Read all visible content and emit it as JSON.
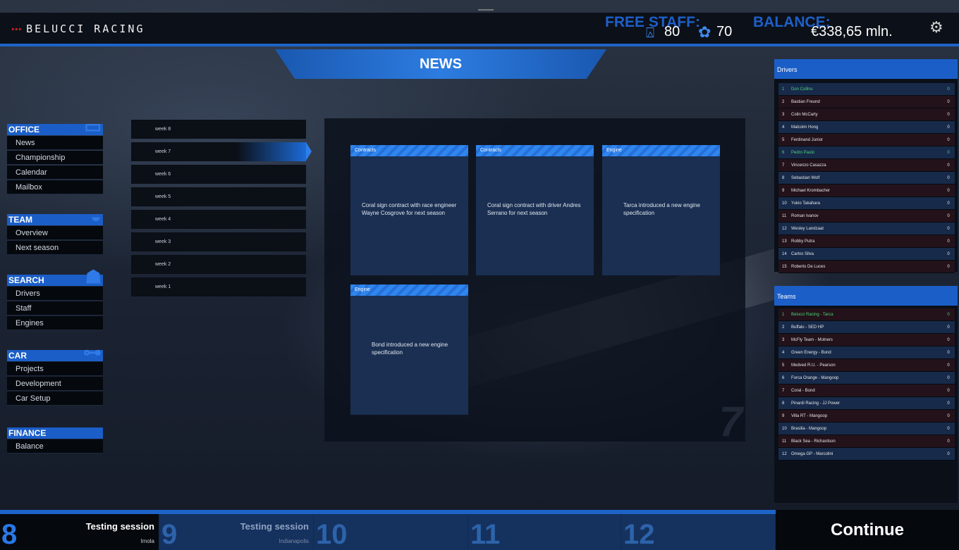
{
  "header": {
    "logo_arrows": "▸▸▸",
    "logo_text": "BELUCCI RACING",
    "free_staff_label": "FREE STAFF:",
    "engineers": "80",
    "mechanics": "70",
    "balance_label": "BALANCE:",
    "balance_value": "€338,65 mln."
  },
  "page_title": "NEWS",
  "menu": {
    "office": {
      "title": "OFFICE",
      "items": [
        "News",
        "Championship",
        "Calendar",
        "Mailbox"
      ]
    },
    "team": {
      "title": "TEAM",
      "items": [
        "Overview",
        "Next season"
      ]
    },
    "search": {
      "title": "SEARCH",
      "items": [
        "Drivers",
        "Staff",
        "Engines"
      ]
    },
    "car": {
      "title": "CAR",
      "items": [
        "Projects",
        "Development",
        "Car Setup"
      ]
    },
    "finance": {
      "title": "FINANCE",
      "items": [
        "Balance"
      ]
    }
  },
  "weeks": [
    "week 8",
    "week 7",
    "week 6",
    "week 5",
    "week 4",
    "week 3",
    "week 2",
    "week 1"
  ],
  "news_week_number": "7",
  "news": [
    {
      "category": "Contracts",
      "text": "Coral sign contract with race engineer Wayne Cosgrove for next season"
    },
    {
      "category": "Contracts",
      "text": "Coral sign contract with driver Andres Serrano for next season"
    },
    {
      "category": "Engine",
      "text": "Tarca introduced a new engine specification"
    },
    {
      "category": "Engine",
      "text": "Bond introduced a new engine specification"
    }
  ],
  "drivers": {
    "title": "Drivers",
    "rows": [
      {
        "pos": "1",
        "name": "Don Collins",
        "pts": "0"
      },
      {
        "pos": "2",
        "name": "Bastian Freund",
        "pts": "0"
      },
      {
        "pos": "3",
        "name": "Colin McCarty",
        "pts": "0"
      },
      {
        "pos": "4",
        "name": "Malcolm Hong",
        "pts": "0"
      },
      {
        "pos": "5",
        "name": "Ferdinand Junior",
        "pts": "0"
      },
      {
        "pos": "6",
        "name": "Pedro Paulo",
        "pts": "0"
      },
      {
        "pos": "7",
        "name": "Vincenzo Casazza",
        "pts": "0"
      },
      {
        "pos": "8",
        "name": "Sebastian Wolf",
        "pts": "0"
      },
      {
        "pos": "9",
        "name": "Michael Krombacher",
        "pts": "0"
      },
      {
        "pos": "10",
        "name": "Yukio Takahara",
        "pts": "0"
      },
      {
        "pos": "11",
        "name": "Roman Ivanov",
        "pts": "0"
      },
      {
        "pos": "12",
        "name": "Wesley Landzaat",
        "pts": "0"
      },
      {
        "pos": "13",
        "name": "Robby Putra",
        "pts": "0"
      },
      {
        "pos": "14",
        "name": "Carlos Silva",
        "pts": "0"
      },
      {
        "pos": "15",
        "name": "Roberto De Luces",
        "pts": "0"
      }
    ]
  },
  "teams": {
    "title": "Teams",
    "rows": [
      {
        "pos": "1",
        "name": "Belucci Racing - Tarca",
        "pts": "0"
      },
      {
        "pos": "2",
        "name": "Buffalo - SED HP",
        "pts": "0"
      },
      {
        "pos": "3",
        "name": "McFly Team - Molners",
        "pts": "0"
      },
      {
        "pos": "4",
        "name": "Green Energy - Bond",
        "pts": "0"
      },
      {
        "pos": "5",
        "name": "Medved R.U. - Pearson",
        "pts": "0"
      },
      {
        "pos": "6",
        "name": "Forca Orange - Mangoop",
        "pts": "0"
      },
      {
        "pos": "7",
        "name": "Coral - Bond",
        "pts": "0"
      },
      {
        "pos": "8",
        "name": "Pinardi Racing - JJ Power",
        "pts": "0"
      },
      {
        "pos": "9",
        "name": "Villa RT - Mangoop",
        "pts": "0"
      },
      {
        "pos": "10",
        "name": "Brasilia - Mangoop",
        "pts": "0"
      },
      {
        "pos": "11",
        "name": "Black Sea - Richardson",
        "pts": "0"
      },
      {
        "pos": "12",
        "name": "Omega GP - Marcolini",
        "pts": "0"
      }
    ]
  },
  "calendar": [
    {
      "num": "8",
      "event": "Testing session",
      "location": "Imola"
    },
    {
      "num": "9",
      "event": "Testing session",
      "location": "Indianapolis"
    },
    {
      "num": "10",
      "event": "",
      "location": ""
    },
    {
      "num": "11",
      "event": "",
      "location": ""
    },
    {
      "num": "12",
      "event": "",
      "location": ""
    }
  ],
  "continue_label": "Continue",
  "colors": {
    "accent": "#1e64c8",
    "highlight": "#4ed37a"
  }
}
